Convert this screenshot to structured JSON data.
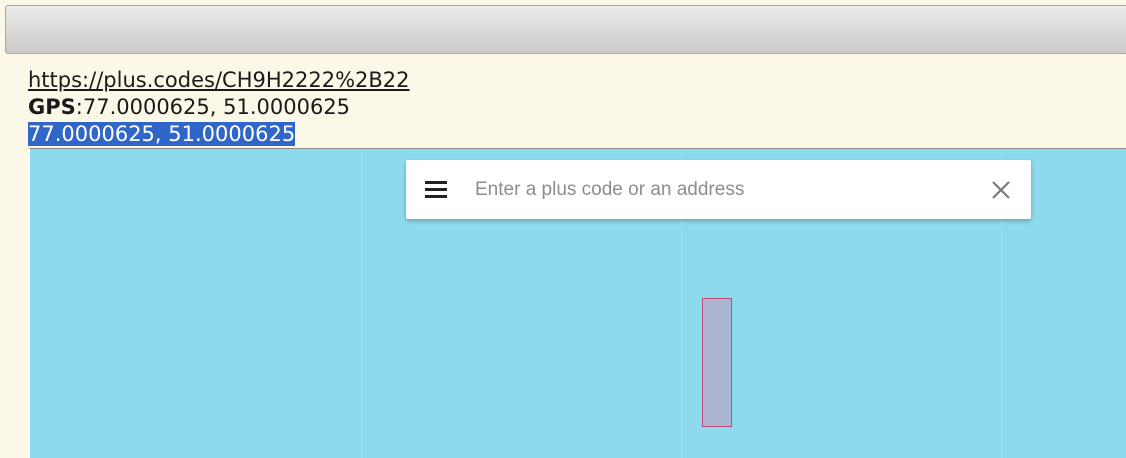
{
  "info": {
    "link_text": "https://plus.codes/CH9H2222%2B22",
    "gps_label": "GPS",
    "gps_separator": ":",
    "gps_value": "77.0000625, 51.0000625",
    "selected_coords": "77.0000625, 51.0000625"
  },
  "search": {
    "placeholder": "Enter a plus code or an address",
    "value": ""
  },
  "icons": {
    "menu": "menu-icon",
    "close": "close-icon"
  },
  "colors": {
    "map_water": "#8cdaec",
    "selection": "#3166c9",
    "code_area_fill": "#acb5d2",
    "code_area_border": "#c0457a",
    "page_background": "#fcf8e8"
  }
}
